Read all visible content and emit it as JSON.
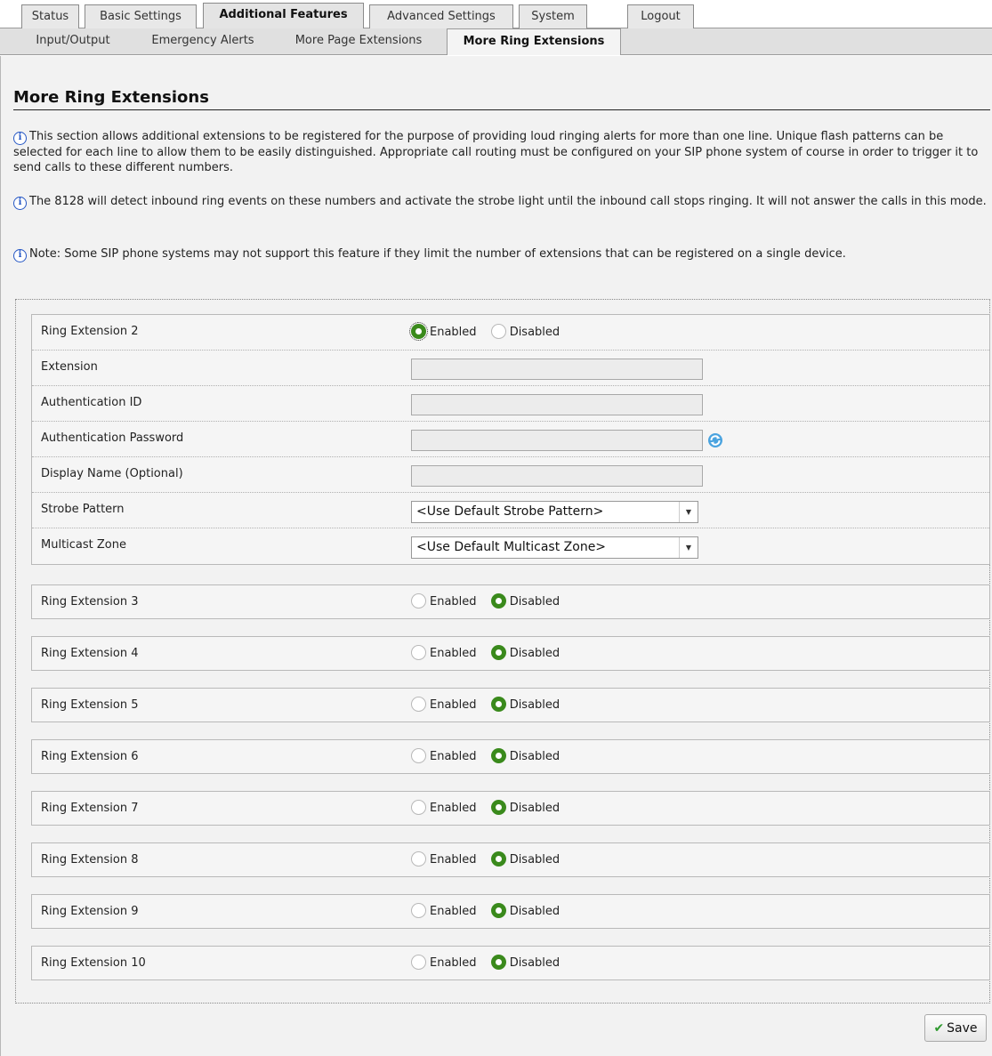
{
  "top_tabs": [
    {
      "label": "Status"
    },
    {
      "label": "Basic Settings"
    },
    {
      "label": "Additional Features",
      "active": true
    },
    {
      "label": "Advanced Settings"
    },
    {
      "label": "System"
    },
    {
      "label": "Logout"
    }
  ],
  "sub_tabs": [
    {
      "label": "Input/Output"
    },
    {
      "label": "Emergency Alerts"
    },
    {
      "label": "More Page Extensions"
    },
    {
      "label": "More Ring Extensions",
      "active": true
    }
  ],
  "page": {
    "title": "More Ring Extensions",
    "info": [
      "This section allows additional extensions to be registered for the purpose of providing loud ringing alerts for more than one line. Unique flash patterns can be selected for each line to allow them to be easily distinguished. Appropriate call routing must be configured on your SIP phone system of course in order to trigger it to send calls to these different numbers.",
      "The 8128 will detect inbound ring events on these numbers and activate the strobe light until the inbound call stops ringing. It will not answer the calls in this mode.",
      "Note: Some SIP phone systems may not support this feature if they limit the number of extensions that can be registered on a single device."
    ]
  },
  "radio_labels": {
    "enabled": "Enabled",
    "disabled": "Disabled"
  },
  "ext2": {
    "label": "Ring Extension 2",
    "state": "enabled",
    "fields": {
      "extension": {
        "label": "Extension",
        "value": ""
      },
      "auth_id": {
        "label": "Authentication ID",
        "value": ""
      },
      "auth_password": {
        "label": "Authentication Password",
        "value": ""
      },
      "display_name": {
        "label": "Display Name (Optional)",
        "value": ""
      },
      "strobe_pattern": {
        "label": "Strobe Pattern",
        "value": "<Use Default Strobe Pattern>"
      },
      "multicast_zone": {
        "label": "Multicast Zone",
        "value": "<Use Default Multicast Zone>"
      }
    }
  },
  "other_extensions": [
    {
      "label": "Ring Extension 3",
      "state": "disabled"
    },
    {
      "label": "Ring Extension 4",
      "state": "disabled"
    },
    {
      "label": "Ring Extension 5",
      "state": "disabled"
    },
    {
      "label": "Ring Extension 6",
      "state": "disabled"
    },
    {
      "label": "Ring Extension 7",
      "state": "disabled"
    },
    {
      "label": "Ring Extension 8",
      "state": "disabled"
    },
    {
      "label": "Ring Extension 9",
      "state": "disabled"
    },
    {
      "label": "Ring Extension 10",
      "state": "disabled"
    }
  ],
  "save_label": "Save",
  "colors": {
    "radio_on": "#3a8a1c",
    "info_icon": "#2456c4",
    "save_check": "#2f9a2f"
  }
}
